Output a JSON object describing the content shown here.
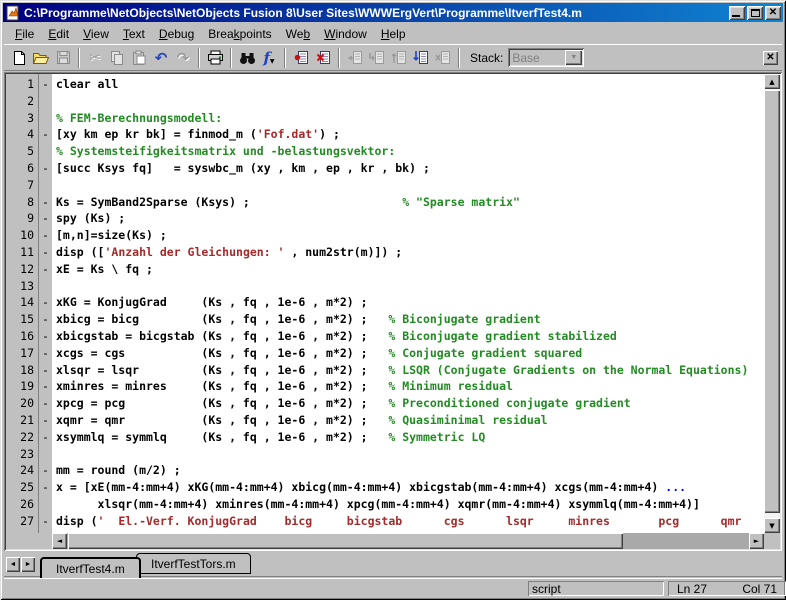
{
  "window": {
    "title": "C:\\Programme\\NetObjects\\NetObjects Fusion 8\\User Sites\\WWWErgVert\\Programme\\ItverfTest4.m"
  },
  "menu": {
    "items": [
      {
        "pre": "",
        "accel": "F",
        "post": "ile"
      },
      {
        "pre": "",
        "accel": "E",
        "post": "dit"
      },
      {
        "pre": "",
        "accel": "V",
        "post": "iew"
      },
      {
        "pre": "",
        "accel": "T",
        "post": "ext"
      },
      {
        "pre": "",
        "accel": "D",
        "post": "ebug"
      },
      {
        "pre": "Brea",
        "accel": "k",
        "post": "points"
      },
      {
        "pre": "We",
        "accel": "b",
        "post": ""
      },
      {
        "pre": "",
        "accel": "W",
        "post": "indow"
      },
      {
        "pre": "",
        "accel": "H",
        "post": "elp"
      }
    ]
  },
  "toolbar": {
    "stack_label": "Stack:",
    "stack_value": "Base",
    "icons": [
      "new-file",
      "open-file",
      "save",
      "cut",
      "copy",
      "paste",
      "undo",
      "redo",
      "print",
      "find",
      "function-browser",
      "toggle-breakpoint",
      "clear-breakpoints",
      "step",
      "step-in",
      "step-out",
      "go-until-cursor",
      "exit-debug",
      "stack-dropdown",
      "toolbar-close"
    ]
  },
  "editor": {
    "lines": [
      {
        "num": "1",
        "dash": true,
        "seg": [
          [
            "c",
            "clear all"
          ]
        ]
      },
      {
        "num": "2",
        "dash": false,
        "seg": []
      },
      {
        "num": "3",
        "dash": false,
        "seg": [
          [
            "m",
            "% FEM-Berechnungsmodell:"
          ]
        ]
      },
      {
        "num": "4",
        "dash": true,
        "seg": [
          [
            "c",
            "[xy km ep kr bk] = finmod_m ("
          ],
          [
            "s",
            "'Fof.dat'"
          ],
          [
            "c",
            ") ;"
          ]
        ]
      },
      {
        "num": "5",
        "dash": false,
        "seg": [
          [
            "m",
            "% Systemsteifigkeitsmatrix und -belastungsvektor:"
          ]
        ]
      },
      {
        "num": "6",
        "dash": true,
        "seg": [
          [
            "c",
            "[succ Ksys fq]   = syswbc_m (xy , km , ep , kr , bk) ;"
          ]
        ]
      },
      {
        "num": "7",
        "dash": false,
        "seg": []
      },
      {
        "num": "8",
        "dash": true,
        "seg": [
          [
            "c",
            "Ks = SymBand2Sparse (Ksys) ;                      "
          ],
          [
            "m",
            "% \"Sparse matrix\""
          ]
        ]
      },
      {
        "num": "9",
        "dash": true,
        "seg": [
          [
            "c",
            "spy (Ks) ;"
          ]
        ]
      },
      {
        "num": "10",
        "dash": true,
        "seg": [
          [
            "c",
            "[m,n]=size(Ks) ;"
          ]
        ]
      },
      {
        "num": "11",
        "dash": true,
        "seg": [
          [
            "c",
            "disp (["
          ],
          [
            "s",
            "'Anzahl der Gleichungen: '"
          ],
          [
            "c",
            " , num2str(m)]) ;"
          ]
        ]
      },
      {
        "num": "12",
        "dash": true,
        "seg": [
          [
            "c",
            "xE = Ks \\ fq ;"
          ]
        ]
      },
      {
        "num": "13",
        "dash": false,
        "seg": []
      },
      {
        "num": "14",
        "dash": true,
        "seg": [
          [
            "c",
            "xKG = KonjugGrad     (Ks , fq , 1e-6 , m*2) ;"
          ]
        ]
      },
      {
        "num": "15",
        "dash": true,
        "seg": [
          [
            "c",
            "xbicg = bicg         (Ks , fq , 1e-6 , m*2) ;   "
          ],
          [
            "m",
            "% Biconjugate gradient"
          ]
        ]
      },
      {
        "num": "16",
        "dash": true,
        "seg": [
          [
            "c",
            "xbicgstab = bicgstab (Ks , fq , 1e-6 , m*2) ;   "
          ],
          [
            "m",
            "% Biconjugate gradient stabilized"
          ]
        ]
      },
      {
        "num": "17",
        "dash": true,
        "seg": [
          [
            "c",
            "xcgs = cgs           (Ks , fq , 1e-6 , m*2) ;   "
          ],
          [
            "m",
            "% Conjugate gradient squared"
          ]
        ]
      },
      {
        "num": "18",
        "dash": true,
        "seg": [
          [
            "c",
            "xlsqr = lsqr         (Ks , fq , 1e-6 , m*2) ;   "
          ],
          [
            "m",
            "% LSQR (Conjugate Gradients on the Normal Equations)"
          ]
        ]
      },
      {
        "num": "19",
        "dash": true,
        "seg": [
          [
            "c",
            "xminres = minres     (Ks , fq , 1e-6 , m*2) ;   "
          ],
          [
            "m",
            "% Minimum residual"
          ]
        ]
      },
      {
        "num": "20",
        "dash": true,
        "seg": [
          [
            "c",
            "xpcg = pcg           (Ks , fq , 1e-6 , m*2) ;   "
          ],
          [
            "m",
            "% Preconditioned conjugate gradient"
          ]
        ]
      },
      {
        "num": "21",
        "dash": true,
        "seg": [
          [
            "c",
            "xqmr = qmr           (Ks , fq , 1e-6 , m*2) ;   "
          ],
          [
            "m",
            "% Quasiminimal residual"
          ]
        ]
      },
      {
        "num": "22",
        "dash": true,
        "seg": [
          [
            "c",
            "xsymmlq = symmlq     (Ks , fq , 1e-6 , m*2) ;   "
          ],
          [
            "m",
            "% Symmetric LQ"
          ]
        ]
      },
      {
        "num": "23",
        "dash": false,
        "seg": []
      },
      {
        "num": "24",
        "dash": true,
        "seg": [
          [
            "c",
            "mm = round (m/2) ;"
          ]
        ]
      },
      {
        "num": "25",
        "dash": true,
        "seg": [
          [
            "c",
            "x = [xE(mm-4:mm+4) xKG(mm-4:mm+4) xbicg(mm-4:mm+4) xbicgstab(mm-4:mm+4) xcgs(mm-4:mm+4) "
          ],
          [
            "x",
            "..."
          ]
        ]
      },
      {
        "num": "26",
        "dash": false,
        "seg": [
          [
            "c",
            "      xlsqr(mm-4:mm+4) xminres(mm-4:mm+4) xpcg(mm-4:mm+4) xqmr(mm-4:mm+4) xsymmlq(mm-4:mm+4)]"
          ]
        ]
      },
      {
        "num": "27",
        "dash": true,
        "seg": [
          [
            "c",
            "disp ("
          ],
          [
            "s",
            "'  El.-Verf. KonjugGrad    bicg     bicgstab      cgs      lsqr     minres       pcg      qmr"
          ]
        ]
      }
    ]
  },
  "tabs": [
    {
      "label": "ItverfTest4.m",
      "active": true
    },
    {
      "label": "ItverfTestTors.m",
      "active": false
    }
  ],
  "statusbar": {
    "mode": "script",
    "line": "Ln 27",
    "col": "Col 71"
  },
  "colors": {
    "titlebar_left": "#000080",
    "titlebar_right": "#1084d0",
    "comment": "#228B22",
    "string": "#A52A2A",
    "continuation": "#0000FF"
  }
}
